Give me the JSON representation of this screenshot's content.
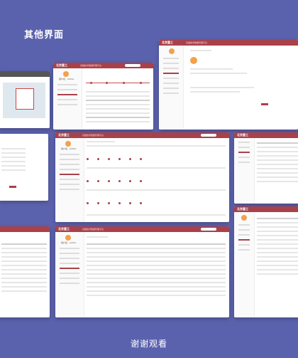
{
  "title": "其他界面",
  "footer": "谢谢观看",
  "brand": "北京重工",
  "system_name": "基础技术数据管理平台",
  "sidebar_user": "用户名：admin",
  "colors": {
    "background": "#5b62ad",
    "header": "#a9414a",
    "accent": "#f3a14a"
  }
}
